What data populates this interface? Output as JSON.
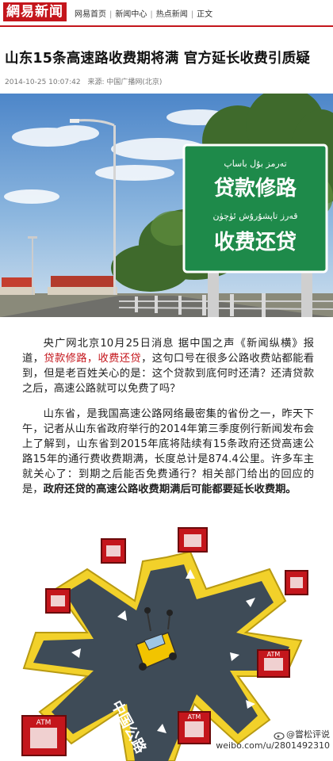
{
  "header": {
    "logo_part1": "網易",
    "logo_part2": "新闻",
    "breadcrumbs": [
      "网易首页",
      "新闻中心",
      "热点新闻",
      "正文"
    ]
  },
  "article": {
    "title": "山东15条高速路收费期将满  官方延长收费引质疑",
    "timestamp": "2014-10-25 10:07:42",
    "source": "来源: 中国广播网(北京)",
    "photo_sign": {
      "line1": "贷款修路",
      "line2": "收费还贷"
    },
    "para1_a": "央广网北京10月25日消息  据中国之声《新闻纵横》报道，",
    "para1_red": "贷款修路，收费还贷",
    "para1_b": "，这句口号在很多公路收费站都能看到，但是老百姓关心的是：这个贷款到底何时还清？还清贷款之后，高速公路就可以免费了吗？",
    "para2_a": "山东省，是我国高速公路网络最密集的省份之一，昨天下午，记者从山东省政府举行的2014年第三季度例行新闻发布会上了解到，山东省到2015年底将陆续有15条政府还贷高速公路15年的通行费收费期满，长度总计是874.4公里。许多车主就关心了：到期之后能否免费通行？相关部门给出的回应的是，",
    "para2_bold": "政府还贷的高速公路收费期满后可能都要延长收费期。"
  },
  "cartoon": {
    "road_text": "中国公路",
    "atm_label": "ATM"
  },
  "watermark": {
    "handle": "@嘗松评说",
    "url": "weibo.com/u/2801492310"
  },
  "colors": {
    "brand_red": "#c4161c",
    "sign_green": "#1e8a4a"
  }
}
